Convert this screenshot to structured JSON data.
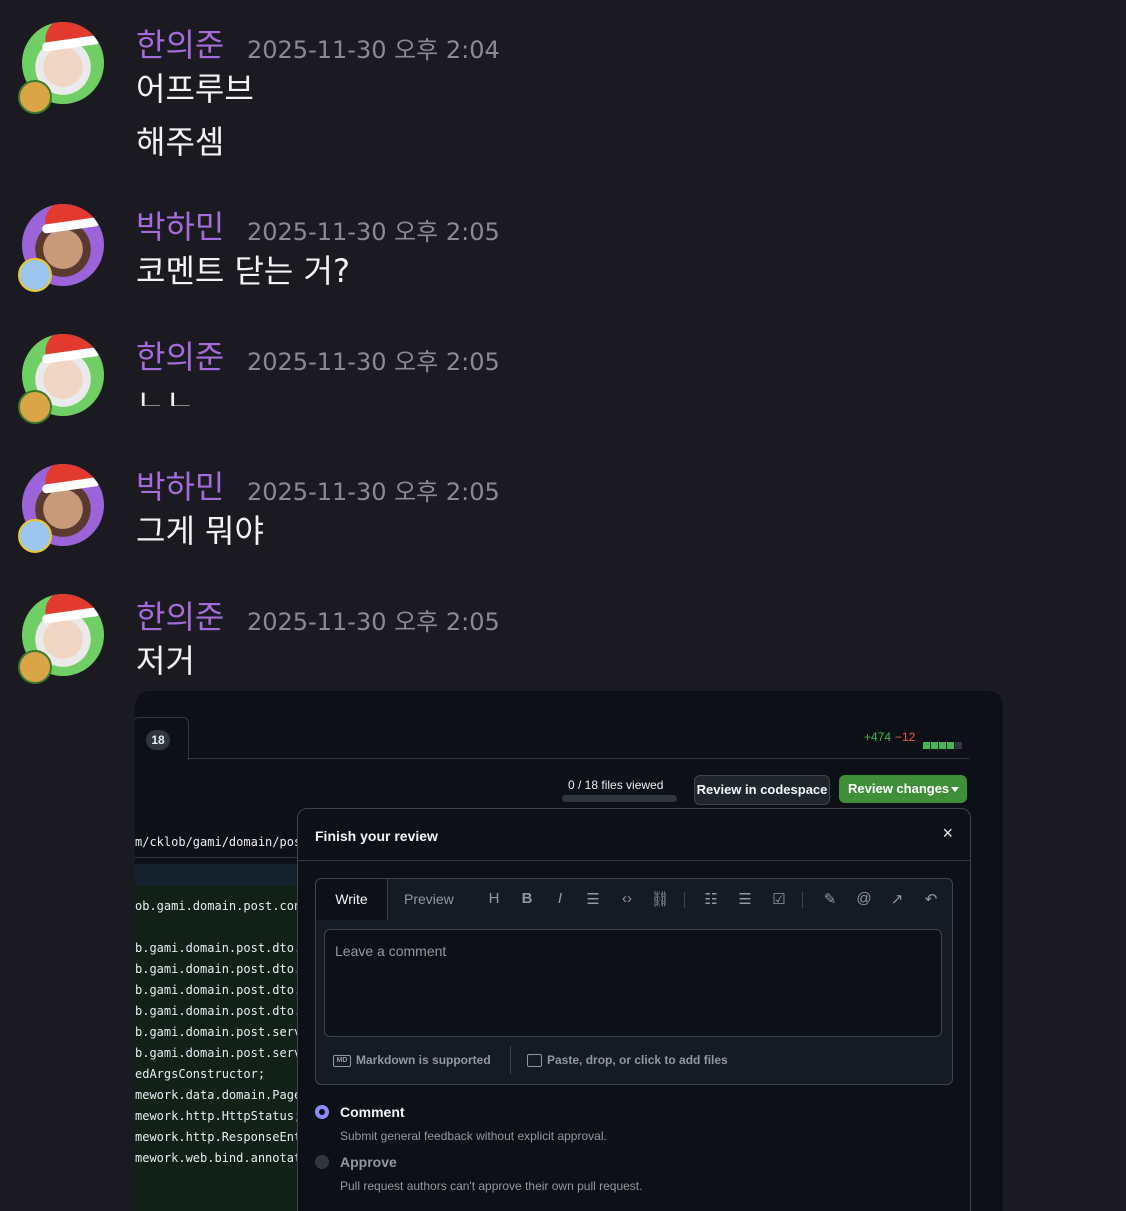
{
  "colors": {
    "name": "#a46cd8",
    "timestamp": "#8b8a93",
    "review_green": "#3f8f3a"
  },
  "messages": [
    {
      "author": "한의준",
      "timestamp": "2025-11-30 오후 2:04",
      "lines": [
        "어프루브",
        "해주셈"
      ],
      "avatar_icon": "santa-hat-avatar-green"
    },
    {
      "author": "박하민",
      "timestamp": "2025-11-30 오후 2:05",
      "lines": [
        "코멘트 닫는 거?"
      ],
      "avatar_icon": "santa-hat-avatar-purple"
    },
    {
      "author": "한의준",
      "timestamp": "2025-11-30 오후 2:05",
      "lines": [
        "ㄴㄴ"
      ],
      "avatar_icon": "santa-hat-avatar-green"
    },
    {
      "author": "박하민",
      "timestamp": "2025-11-30 오후 2:05",
      "lines": [
        "그게 뭐야"
      ],
      "avatar_icon": "santa-hat-avatar-purple"
    },
    {
      "author": "한의준",
      "timestamp": "2025-11-30 오후 2:05",
      "lines": [
        "저거"
      ],
      "avatar_icon": "santa-hat-avatar-green"
    }
  ],
  "attachment": {
    "files_count": "18",
    "additions": "+474",
    "deletions": "−12",
    "files_viewed": "0 / 18 files viewed",
    "review_codespace_label": "Review in codespace",
    "review_changes_label": "Review changes",
    "file_path": "m/cklob/gami/domain/post",
    "code_lines": [
      "ob.gami.domain.post.con",
      "b.gami.domain.post.dto.",
      "b.gami.domain.post.dto.",
      "b.gami.domain.post.dto.",
      "b.gami.domain.post.dto.",
      "b.gami.domain.post.serv",
      "b.gami.domain.post.serv",
      "edArgsConstructor;",
      "mework.data.domain.Page",
      "mework.http.HttpStatus;",
      "mework.http.ResponseEnt",
      "mework.web.bind.annotat"
    ],
    "modal": {
      "title": "Finish your review",
      "close_icon": "×",
      "tab_write": "Write",
      "tab_preview": "Preview",
      "comment_placeholder": "Leave a comment",
      "markdown_note": "Markdown is supported",
      "markdown_icon": "MD",
      "attach_note": "Paste, drop, or click to add files",
      "options": [
        {
          "label": "Comment",
          "description": "Submit general feedback without explicit approval.",
          "selected": true
        },
        {
          "label": "Approve",
          "description": "Pull request authors can't approve their own pull request.",
          "selected": false
        }
      ]
    }
  }
}
